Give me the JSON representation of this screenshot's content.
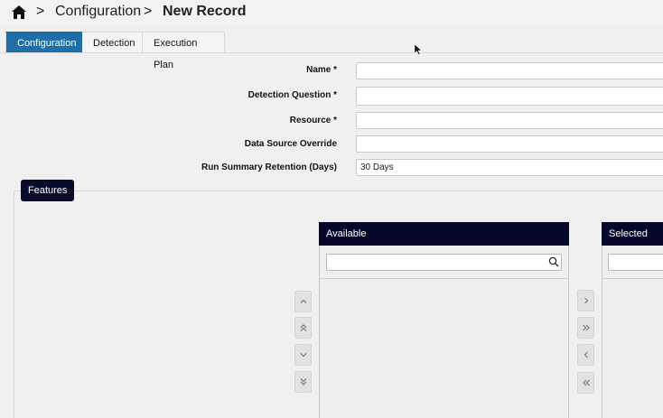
{
  "breadcrumb": {
    "items": [
      "Configuration",
      "New Record"
    ]
  },
  "tabs": [
    {
      "label": "Configuration",
      "active": true
    },
    {
      "label": "Detection",
      "active": false
    },
    {
      "label": "Execution Plan",
      "active": false
    }
  ],
  "form": {
    "fields": [
      {
        "label": "Name *",
        "value": ""
      },
      {
        "label": "Detection Question *",
        "value": ""
      },
      {
        "label": "Resource *",
        "value": ""
      },
      {
        "label": "Data Source Override",
        "value": ""
      },
      {
        "label": "Run Summary Retention (Days)",
        "value": "30 Days"
      }
    ]
  },
  "features": {
    "legend": "Features",
    "available": {
      "header": "Available",
      "search_value": ""
    },
    "selected": {
      "header": "Selected",
      "search_value": ""
    }
  },
  "colors": {
    "active_tab": "#1e6ea8",
    "list_header": "#06062b",
    "legend": "#0a0a2a"
  }
}
